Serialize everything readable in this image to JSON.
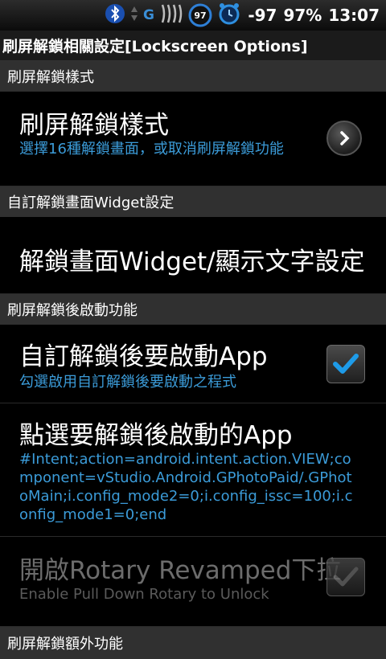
{
  "status_bar": {
    "battery_circle": "97",
    "signal_text": "-97",
    "battery_text": "97%",
    "time": "13:07",
    "icons": [
      "bluetooth-icon",
      "data-arrows-icon",
      "g-network-icon",
      "wifi-waves-icon",
      "battery-circle-icon",
      "alarm-clock-icon"
    ]
  },
  "title": "刷屏解鎖相關設定[Lockscreen Options]",
  "sections": [
    {
      "header": "刷屏解鎖樣式",
      "rows": [
        {
          "title": "刷屏解鎖樣式",
          "subtitle": "選擇16種解鎖畫面，或取消刷屏解鎖功能",
          "control": "chevron"
        }
      ]
    },
    {
      "header": "自訂解鎖畫面Widget設定",
      "rows": [
        {
          "title": "解鎖畫面Widget/顯示文字設定"
        }
      ]
    },
    {
      "header": "刷屏解鎖後啟動功能",
      "rows": [
        {
          "title": "自訂解鎖後要啟動App",
          "subtitle": "勾選啟用自訂解鎖後要啟動之程式",
          "control": "checkbox",
          "checked": true
        },
        {
          "title": "點選要解鎖後啟動的App",
          "subtitle": "#Intent;action=android.intent.action.VIEW;component=vStudio.Android.GPhotoPaid/.GPhotoMain;i.config_mode2=0;i.config_issc=100;i.config_mode1=0;end"
        },
        {
          "title": "開啟Rotary Revamped下拉",
          "subtitle": "Enable Pull Down Rotary to Unlock",
          "control": "checkbox",
          "checked": true,
          "disabled": true
        }
      ]
    },
    {
      "header": "刷屏解鎖額外功能"
    }
  ],
  "colors": {
    "accent": "#3b9bd8",
    "check": "#1e9be8",
    "section_bg": "#303030"
  }
}
